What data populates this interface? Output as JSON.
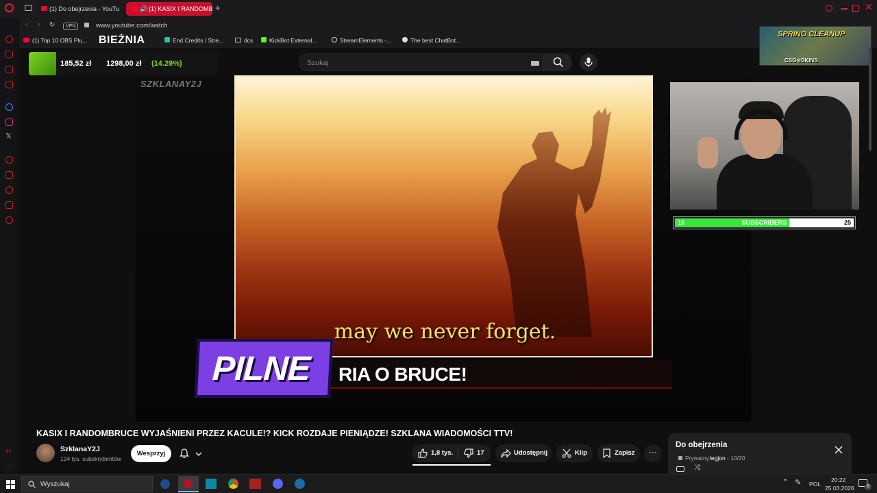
{
  "tabs": [
    {
      "label": "(1) Do obejrzenia - YouTube",
      "active": false
    },
    {
      "label": "(1) KASIX I RANDOMBRUCE",
      "active": true
    }
  ],
  "address": {
    "url": "www.youtube.com/watch",
    "vpn": "VPN"
  },
  "bookmarks": [
    "(1) Top 10 OBS Plu...",
    "End Credits / Stre...",
    "dcs",
    "KickBot External...",
    "StreamElements -...",
    "The best ChatBot..."
  ],
  "overlay": {
    "biezna": "BIEŻNIA",
    "ticker_left": "185,52 zł",
    "ticker_value": "1298,00 zł",
    "ticker_pct": "(14.29%)",
    "watermark": "SZKLANAY2J",
    "subtitle": "may we never forget.",
    "pilne": "PILNE",
    "headline": "RIA O BRUCE!",
    "sub_left": "16",
    "sub_label": "SUBSCRIBERS",
    "sub_right": "25",
    "sub_progress": 0.64,
    "ad_title": "SPRING CLEANUP",
    "ad_brand": "CSG⊙SKINS"
  },
  "search": {
    "placeholder": "Szukaj"
  },
  "video": {
    "title": "KASIX I RANDOMBRUCE WYJAŚNIENI PRZEZ KACULE!? KICK ROZDAJE PIENIĄDZE! SZKLANA WIADOMOŚCI TTV!",
    "channel": "SzklanaY2J",
    "subscribers": "124 tys. subskrybentów",
    "support_label": "Wesprzyj",
    "likes": "1,8 tys.",
    "dislikes": "17",
    "share_label": "Udostępnij",
    "clip_label": "Klip",
    "save_label": "Zapisz"
  },
  "playlist": {
    "title": "Do obejrzenia",
    "privacy": "Prywatny",
    "owner": "legjon",
    "progress": "- 10/20"
  },
  "taskbar": {
    "search_placeholder": "Wyszukaj",
    "lang": "POL",
    "time": "20:22",
    "date": "25.03.2026",
    "notif_count": "6"
  },
  "colors": {
    "accent": "#c8102e",
    "youtube_red": "#ff0033",
    "ticker_green": "#7ed321",
    "pilne_purple": "#7b3fe4",
    "sub_bar": "#39e73b"
  }
}
